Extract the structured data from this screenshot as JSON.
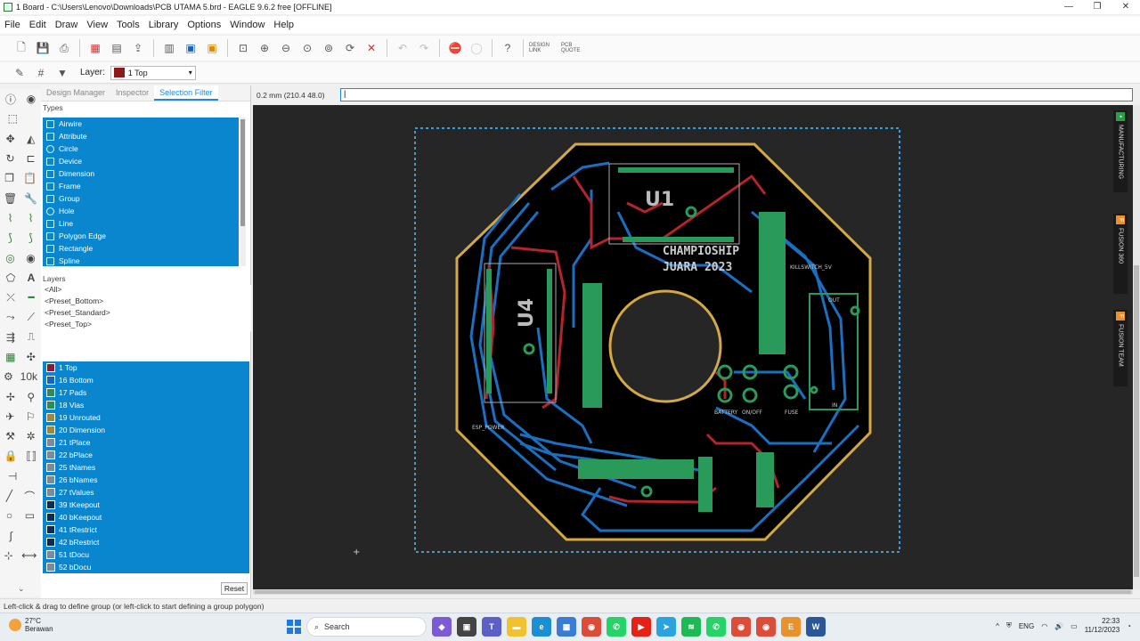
{
  "window": {
    "title": "1 Board - C:\\Users\\Lenovo\\Downloads\\PCB UTAMA 5.brd - EAGLE 9.6.2 free [OFFLINE]"
  },
  "menu": [
    "File",
    "Edit",
    "Draw",
    "View",
    "Tools",
    "Library",
    "Options",
    "Window",
    "Help"
  ],
  "toolbar": {
    "layer_label": "Layer:",
    "layer_value": "1 Top",
    "design_link": "DESIGN LINK",
    "pcb_quote": "PCB QUOTE"
  },
  "panel": {
    "tabs": [
      "Design Manager",
      "Inspector",
      "Selection Filter"
    ],
    "types_header": "Types",
    "types": [
      "Airwire",
      "Attribute",
      "Circle",
      "Device",
      "Dimension",
      "Frame",
      "Group",
      "Hole",
      "Line",
      "Polygon Edge",
      "Rectangle",
      "Spline"
    ],
    "layers_header": "Layers",
    "presets": [
      "<All>",
      "<Preset_Bottom>",
      "<Preset_Standard>",
      "<Preset_Top>"
    ],
    "layers": [
      {
        "name": "1 Top",
        "color": "#8b1a3a"
      },
      {
        "name": "16 Bottom",
        "color": "#1565c0"
      },
      {
        "name": "17 Pads",
        "color": "#2e8b57"
      },
      {
        "name": "18 Vias",
        "color": "#2e8b57"
      },
      {
        "name": "19 Unrouted",
        "color": "#9a8a3a"
      },
      {
        "name": "20 Dimension",
        "color": "#9a8a3a"
      },
      {
        "name": "21 tPlace",
        "color": "#7a8aa0"
      },
      {
        "name": "22 bPlace",
        "color": "#7a8aa0"
      },
      {
        "name": "25 tNames",
        "color": "#7a8aa0"
      },
      {
        "name": "26 bNames",
        "color": "#7a8aa0"
      },
      {
        "name": "27 tValues",
        "color": "#7a8aa0"
      },
      {
        "name": "39 tKeepout",
        "color": "#0d2b55"
      },
      {
        "name": "40 bKeepout",
        "color": "#0d2b55"
      },
      {
        "name": "41 tRestrict",
        "color": "#0d2b55"
      },
      {
        "name": "42 bRestrict",
        "color": "#0d2b55"
      },
      {
        "name": "51 tDocu",
        "color": "#7a8aa0"
      },
      {
        "name": "52 bDocu",
        "color": "#7a8aa0"
      }
    ],
    "reset_label": "Reset"
  },
  "coord": "0.2 mm (210.4 48.0)",
  "board": {
    "u1": "U1",
    "u4": "U4",
    "line1": "CHAMPIOSHIP",
    "line2": "JUARA 2023",
    "kill_switch": "KILLSWITCH_5V",
    "esp_power": "ESP_POWER",
    "battery": "BATTERY",
    "on_off": "ON/OFF",
    "fuse": "FUSE",
    "out": "OUT",
    "in": "IN"
  },
  "right_tabs": [
    "MANUFACTURING",
    "FUSION 360",
    "FUSION TEAM"
  ],
  "status": "Left-click & drag to define group (or left-click to start defining a group polygon)",
  "taskbar": {
    "temp": "27°C",
    "weather": "Berawan",
    "search": "Search",
    "lang": "ENG",
    "time": "22:33",
    "date": "11/12/2023"
  }
}
